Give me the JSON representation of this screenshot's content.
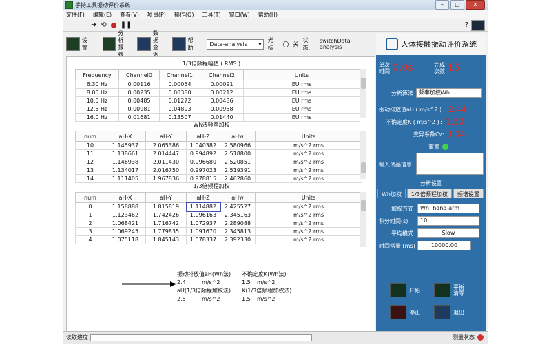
{
  "window": {
    "title": "手持工具振动评价系统"
  },
  "menu": [
    "文件(F)",
    "编辑(E)",
    "查看(V)",
    "项目(P)",
    "操作(O)",
    "工具(T)",
    "窗口(W)",
    "帮助(H)"
  ],
  "toolbar": {
    "settings": "设置",
    "analysis_report": [
      "分析",
      "报表"
    ],
    "data_query": [
      "数据",
      "查询"
    ],
    "help": "帮助",
    "mode_select": "Data-analysis",
    "cursor_label": "光标",
    "cursor_state": "关",
    "status_label": "状态:",
    "status_value": "switchData-analysis"
  },
  "table1": {
    "title": "1/3倍频程幅值 ( RMS )",
    "headers": [
      "Frequency",
      "Channel0",
      "Channel1",
      "Channel2",
      "Units"
    ],
    "rows": [
      [
        "6.30 Hz",
        "0.00116",
        "0.00054",
        "0.00091",
        "EU rms"
      ],
      [
        "8.00 Hz",
        "0.00235",
        "0.00380",
        "0.00212",
        "EU rms"
      ],
      [
        "10.0 Hz",
        "0.00485",
        "0.01272",
        "0.00486",
        "EU rms"
      ],
      [
        "12.5 Hz",
        "0.00981",
        "0.04803",
        "0.00958",
        "EU rms"
      ],
      [
        "16.0 Hz",
        "0.01681",
        "0.13507",
        "0.01440",
        "EU rms"
      ]
    ]
  },
  "table2": {
    "title": "Wh法频率加权",
    "headers": [
      "num",
      "aH-X",
      "aH-Y",
      "aH-Z",
      "aHw",
      "Units"
    ],
    "rows": [
      [
        "10",
        "1.145937",
        "2.065386",
        "1.040382",
        "2.580966",
        "m/s^2 rms"
      ],
      [
        "11",
        "1.138661",
        "2.014447",
        "0.994892",
        "2.518800",
        "m/s^2 rms"
      ],
      [
        "12",
        "1.146938",
        "2.011430",
        "0.996680",
        "2.520851",
        "m/s^2 rms"
      ],
      [
        "13",
        "1.134017",
        "2.016750",
        "0.997023",
        "2.519391",
        "m/s^2 rms"
      ],
      [
        "14",
        "1.111405",
        "1.967836",
        "0.978815",
        "2.462860",
        "m/s^2 rms"
      ]
    ]
  },
  "table3": {
    "title": "1/3倍频程加权",
    "headers": [
      "num",
      "aH-X",
      "aH-Y",
      "aH-Z",
      "aHw",
      "Units"
    ],
    "rows": [
      [
        "0",
        "1.158888",
        "1.815819",
        "1.114882",
        "2.425527",
        "m/s^2 rms"
      ],
      [
        "1",
        "1.123462",
        "1.742426",
        "1.096163",
        "2.345163",
        "m/s^2 rms"
      ],
      [
        "2",
        "1.068421",
        "1.716742",
        "1.072937",
        "2.289088",
        "m/s^2 rms"
      ],
      [
        "3",
        "1.069245",
        "1.779835",
        "1.091670",
        "2.345813",
        "m/s^2 rms"
      ],
      [
        "4",
        "1.075118",
        "1.845143",
        "1.078337",
        "2.392330",
        "m/s^2 rms"
      ]
    ]
  },
  "summary": {
    "vib_wh_label": "振动排放值aH(Wh法)",
    "vib_wh_value": "2.4",
    "vib_wh_unit": "m/s^2",
    "unc_wh_label": "不确定度K(Wh法)",
    "unc_wh_value": "1.5",
    "unc_wh_unit": "m/s^2",
    "vib_oct_label": "aH(1/3倍频程加权法)",
    "vib_oct_value": "2.5",
    "vib_oct_unit": "m/s^2",
    "unc_oct_label": "K(1/3倍频程加权法)",
    "unc_oct_value": "1.5",
    "unc_oct_unit": "m/s^2"
  },
  "right": {
    "title": "人体接触振动评价系统",
    "single_time_label": [
      "单次",
      "时间"
    ],
    "single_time_value": "0.0s",
    "complete_label": [
      "完成",
      "次数"
    ],
    "complete_value": "15",
    "algo_label": "分析算法",
    "algo_value": "频率加权Wh",
    "vib_label": "振动排放值aH ( m/s^2 ) :",
    "vib_value": "2.44",
    "unc_label": "不确定度K ( m/s^2 ) :",
    "unc_value": "1.50",
    "cv_label": "变异系数Cv:",
    "cv_value": "0.04",
    "reset_label": "重置",
    "input_label": "輸入试品信息",
    "settings_label": "分析设置",
    "tabs": [
      "Wh加权",
      "1/3倍频程加权",
      "频谱设置"
    ],
    "weight_label": "加权方式",
    "weight_value": "Wh: hand-arm",
    "integ_label": "积分时间(s)",
    "integ_value": "10",
    "avg_label": "平均模式",
    "avg_value": "Slow",
    "tc_label": "时间常量 [ms]",
    "tc_value": "10000.00",
    "btn_start": "开始",
    "btn_balance": [
      "平衡",
      "清零"
    ],
    "btn_stop": "停止",
    "btn_exit": "退出"
  },
  "status": {
    "progress_label": "读取进度",
    "measure_label": "测量状态"
  }
}
